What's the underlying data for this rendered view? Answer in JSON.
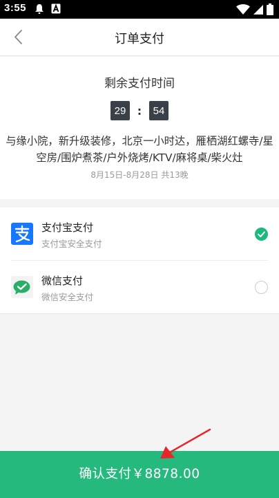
{
  "status_bar": {
    "time": "3:55"
  },
  "header": {
    "title": "订单支付"
  },
  "countdown": {
    "label": "剩余支付时间",
    "minutes": "29",
    "separator": ":",
    "seconds": "54"
  },
  "product": {
    "title_line1": "与缘小院，新升级装修，北京一小时达，雁栖湖红螺寺/星",
    "title_line2": "空房/围炉煮茶/户外烧烤/KTV/麻将桌/柴火灶",
    "date_range": "8月15日-8月28日  共13晚"
  },
  "payment_methods": [
    {
      "name": "支付宝支付",
      "desc": "支付宝安全支付",
      "selected": true,
      "icon": "alipay-icon"
    },
    {
      "name": "微信支付",
      "desc": "微信安全支付",
      "selected": false,
      "icon": "wechat-icon"
    }
  ],
  "confirm": {
    "label": "确认支付￥8878.00"
  },
  "colors": {
    "accent": "#26b97e",
    "alipay": "#1677ff",
    "wechat": "#2aae67",
    "arrow": "#e6262b"
  }
}
